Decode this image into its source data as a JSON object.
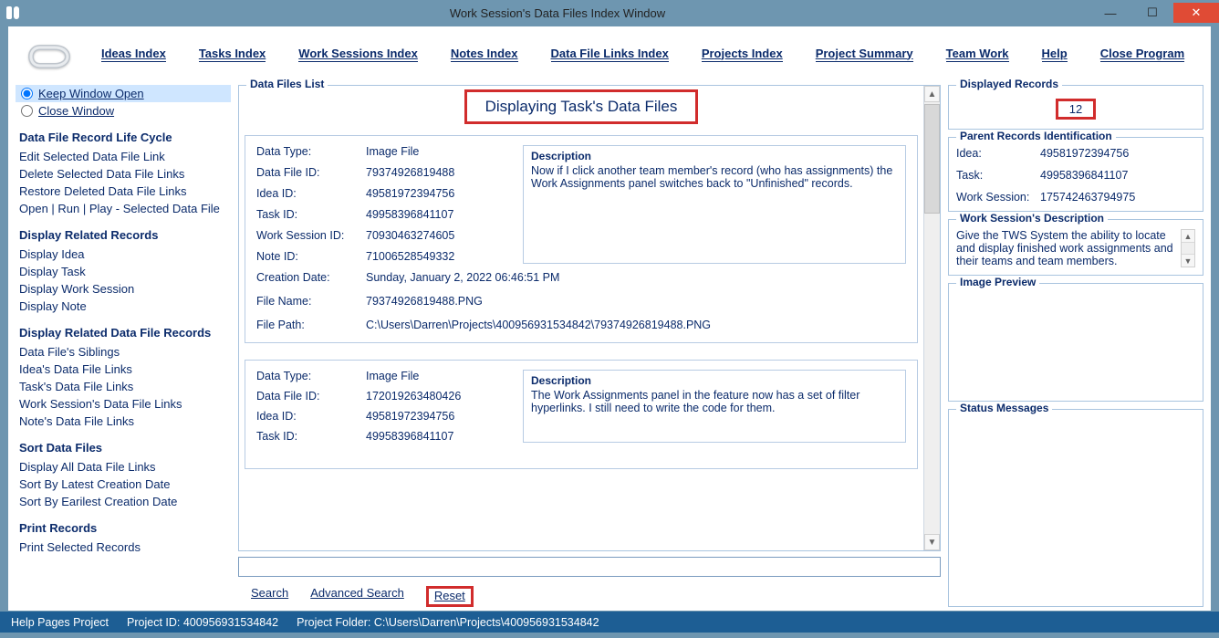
{
  "window": {
    "title": "Work Session's Data Files Index Window"
  },
  "menu": {
    "ideas": "Ideas Index",
    "tasks": "Tasks Index",
    "work_sessions": "Work Sessions Index",
    "notes": "Notes Index",
    "data_file_links": "Data File Links Index",
    "projects": "Projects Index",
    "project_summary": "Project Summary",
    "team_work": "Team Work",
    "help": "Help",
    "close_program": "Close Program"
  },
  "left": {
    "keep_open": "Keep Window Open",
    "close_window": "Close Window",
    "sec_lifecycle": "Data File Record Life Cycle",
    "edit_link": "Edit Selected Data File Link",
    "delete_links": "Delete Selected Data File Links",
    "restore_links": "Restore Deleted Data File Links",
    "open_run_play": "Open | Run | Play - Selected Data File",
    "sec_related": "Display Related Records",
    "display_idea": "Display Idea",
    "display_task": "Display Task",
    "display_ws": "Display Work Session",
    "display_note": "Display Note",
    "sec_related_df": "Display Related Data File Records",
    "siblings": "Data File's Siblings",
    "idea_links": "Idea's Data File Links",
    "task_links": "Task's Data File Links",
    "ws_links": "Work Session's Data File Links",
    "note_links": "Note's Data File Links",
    "sec_sort": "Sort Data Files",
    "display_all": "Display All Data File Links",
    "sort_latest": "Sort By Latest Creation Date",
    "sort_earliest": "Sort By Earilest Creation Date",
    "sec_print": "Print Records",
    "print_selected": "Print Selected Records"
  },
  "center": {
    "list_legend": "Data Files List",
    "list_title": "Displaying Task's Data Files",
    "labels": {
      "data_type": "Data Type:",
      "data_file_id": "Data File ID:",
      "idea_id": "Idea ID:",
      "task_id": "Task ID:",
      "ws_id": "Work Session ID:",
      "note_id": "Note ID:",
      "creation_date": "Creation Date:",
      "file_name": "File Name:",
      "file_path": "File Path:",
      "description": "Description"
    },
    "cards": [
      {
        "data_type": "Image File",
        "data_file_id": "79374926819488",
        "idea_id": "49581972394756",
        "task_id": "49958396841107",
        "ws_id": "70930463274605",
        "note_id": "71006528549332",
        "creation_date": "Sunday, January 2, 2022   06:46:51 PM",
        "file_name": "79374926819488.PNG",
        "file_path": "C:\\Users\\Darren\\Projects\\400956931534842\\79374926819488.PNG",
        "description": "Now if I click another team member's record (who has assignments) the Work Assignments panel switches back to \"Unfinished\" records."
      },
      {
        "data_type": "Image File",
        "data_file_id": "172019263480426",
        "idea_id": "49581972394756",
        "task_id": "49958396841107",
        "description": "The Work Assignments panel in the feature now has a set of filter hyperlinks. I still need to write the code for them."
      }
    ],
    "search": "Search",
    "advanced_search": "Advanced Search",
    "reset": "Reset"
  },
  "right": {
    "displayed_records_legend": "Displayed Records",
    "displayed_records_value": "12",
    "parents_legend": "Parent Records Identification",
    "parent_labels": {
      "idea": "Idea:",
      "task": "Task:",
      "ws": "Work Session:"
    },
    "parents": {
      "idea": "49581972394756",
      "task": "49958396841107",
      "ws": "175742463794975"
    },
    "ws_desc_legend": "Work Session's Description",
    "ws_desc": "Give the TWS System the ability to locate and display finished work assignments and their teams and team members.",
    "image_preview_legend": "Image Preview",
    "status_legend": "Status Messages"
  },
  "status": {
    "help_project": "Help Pages Project",
    "project_id_label": "Project ID: ",
    "project_id": "400956931534842",
    "project_folder_label": "Project Folder: ",
    "project_folder": "C:\\Users\\Darren\\Projects\\400956931534842"
  }
}
